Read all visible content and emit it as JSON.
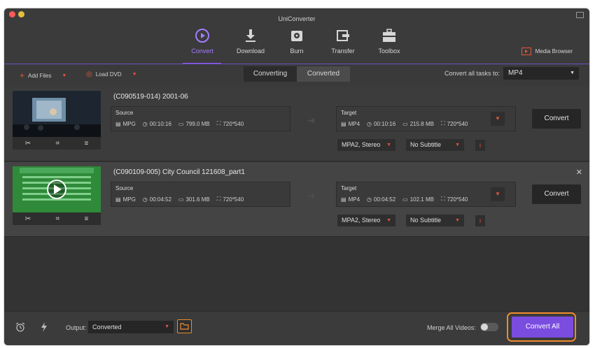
{
  "window": {
    "title": "UniConverter"
  },
  "toolbar": {
    "items": [
      {
        "label": "Convert",
        "icon": "convert-icon",
        "active": true
      },
      {
        "label": "Download",
        "icon": "download-icon",
        "active": false
      },
      {
        "label": "Burn",
        "icon": "burn-icon",
        "active": false
      },
      {
        "label": "Transfer",
        "icon": "transfer-icon",
        "active": false
      },
      {
        "label": "Toolbox",
        "icon": "toolbox-icon",
        "active": false
      }
    ],
    "media_browser": "Media Browser"
  },
  "subbar": {
    "add_files": "Add Files",
    "load_dvd": "Load DVD",
    "tabs": [
      "Converting",
      "Converted"
    ],
    "convert_all_label": "Convert all tasks to:",
    "convert_all_format": "MP4"
  },
  "files": [
    {
      "title": "(C090519-014)  2001-06",
      "source": {
        "label": "Source",
        "format": "MPG",
        "duration": "00:10:16",
        "size": "799.0 MB",
        "resolution": "720*540"
      },
      "target": {
        "label": "Target",
        "format": "MP4",
        "duration": "00:10:16",
        "size": "215.8 MB",
        "resolution": "720*540"
      },
      "audio": "MPA2, Stereo",
      "subtitle": "No Subtitle",
      "convert_label": "Convert"
    },
    {
      "title": "(C090109-005)  City Council 121608_part1",
      "source": {
        "label": "Source",
        "format": "MPG",
        "duration": "00:04:52",
        "size": "301.6 MB",
        "resolution": "720*540"
      },
      "target": {
        "label": "Target",
        "format": "MP4",
        "duration": "00:04:52",
        "size": "102.1 MB",
        "resolution": "720*540"
      },
      "audio": "MPA2, Stereo",
      "subtitle": "No Subtitle",
      "convert_label": "Convert"
    }
  ],
  "bottom": {
    "output_label": "Output:",
    "output_value": "Converted",
    "merge_label": "Merge All Videos:",
    "convert_all_button": "Convert All"
  },
  "colors": {
    "accent": "#7b4ce0",
    "highlight": "#f08a2c",
    "caret": "#e4573a"
  }
}
